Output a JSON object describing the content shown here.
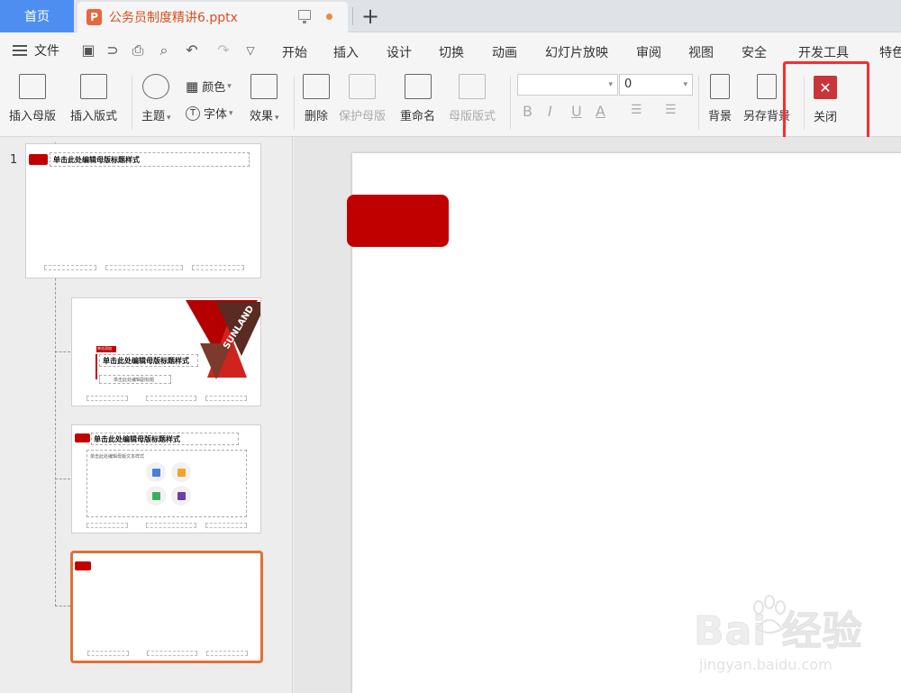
{
  "tabs": {
    "home": "首页",
    "doc_title": "公务员制度精讲6.pptx",
    "add": "+"
  },
  "menu": {
    "file": "文件",
    "items": [
      "开始",
      "插入",
      "设计",
      "切换",
      "动画",
      "幻灯片放映",
      "审阅",
      "视图",
      "安全",
      "开发工具",
      "特色"
    ]
  },
  "ribbon": {
    "insert_master": "插入母版",
    "insert_layout": "插入版式",
    "theme": "主题",
    "color": "颜色",
    "font": "字体",
    "effect": "效果",
    "delete": "删除",
    "protect_master": "保护母版",
    "rename": "重命名",
    "master_layout": "母版版式",
    "font_name": "",
    "font_size": "0",
    "bold": "B",
    "italic": "I",
    "underline": "U",
    "font_color": "A",
    "background": "背景",
    "save_background": "另存背景",
    "close": "关闭"
  },
  "thumbnails": {
    "slide1_number": "1",
    "title_placeholder": "单击此处编辑母版标题样式",
    "subtitle_placeholder": "单击此处编辑副标题",
    "text_placeholder": "单击此处编辑母版文本样式",
    "tag_text": "单击添加",
    "brand_text": "SUNLAND"
  },
  "watermark": {
    "logo": "Bai  经验",
    "url": "jingyan.baidu.com"
  },
  "colors": {
    "accent_red": "#c00000",
    "selection_orange": "#e07033",
    "highlight_red": "#ff2a2a",
    "home_tab_blue": "#4e8ef0"
  }
}
